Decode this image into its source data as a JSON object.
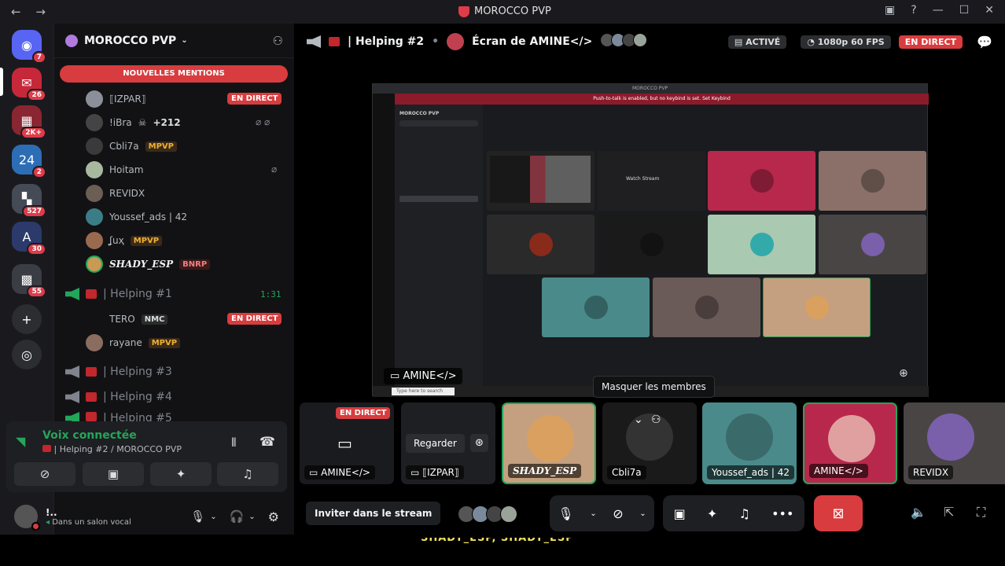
{
  "window": {
    "title": "MOROCCO PVP"
  },
  "colors": {
    "accent_red": "#d83c3e",
    "online_green": "#23a55a",
    "tag_gold": "#f0b132"
  },
  "rail": {
    "servers": [
      {
        "icon": "discord-icon",
        "badge": "7"
      },
      {
        "icon": "server-icon",
        "badge": "26"
      },
      {
        "icon": "server-icon",
        "badge": "2K+"
      },
      {
        "icon": "server-icon",
        "badge": "2"
      },
      {
        "icon": "server-icon",
        "badge": "527"
      },
      {
        "icon": "server-icon",
        "badge": "30"
      },
      {
        "icon": "server-icon",
        "badge": "55"
      }
    ]
  },
  "sidebar": {
    "server_name": "MOROCCO PVP",
    "mentions_banner": "NOUVELLES MENTIONS",
    "members": [
      {
        "name": "⟦IZPAR⟧",
        "live": "EN DIRECT"
      },
      {
        "name": "!iBra",
        "extra": "+212"
      },
      {
        "name": "Cbli7a",
        "tag": "MPVP"
      },
      {
        "name": "Hoitam"
      },
      {
        "name": "REVIDX"
      },
      {
        "name": "Youssef_ads | 42"
      },
      {
        "name": "ʆuҳ",
        "tag": "MPVP"
      },
      {
        "name": "SHADY_ESP",
        "tag": "BNRP"
      }
    ],
    "channels": [
      {
        "name": "| Helping #1",
        "time": "1:31"
      },
      {
        "name": "| Helping #3"
      },
      {
        "name": "| Helping #4"
      },
      {
        "name": "| Helping #5"
      }
    ],
    "channel1_members": [
      {
        "name": "TERO",
        "tag": "NMC",
        "live": "EN DIRECT"
      },
      {
        "name": "rayane",
        "tag": "MPVP"
      }
    ],
    "voice": {
      "title": "Voix connectée",
      "subtitle": "| Helping #2 / MOROCCO PVP"
    },
    "user": {
      "name": "!..",
      "status": "Dans un salon vocal"
    }
  },
  "header": {
    "channel": "| Helping #2",
    "screen_title": "Écran de AMINE</>",
    "active": "ACTIVÉ",
    "quality": "1080p 60 FPS",
    "live": "EN DIRECT"
  },
  "stream": {
    "title_bar": "MOROCCO PVP",
    "notice": "Push-to-talk is enabled, but no keybind is set.   Set Keybind",
    "watch_label": "Watch Stream",
    "owner_label": "AMINE</>",
    "taskbar_search": "Type here to search"
  },
  "tooltip": "Masquer les membres",
  "tiles": [
    {
      "label": "AMINE</>",
      "live": "EN DIRECT"
    },
    {
      "label": "⟦IZPAR⟧",
      "watch": "Regarder"
    },
    {
      "label": "SHADY_ESP"
    },
    {
      "label": "Cbli7a"
    },
    {
      "label": "Youssef_ads | 42"
    },
    {
      "label": "AMINE</>"
    },
    {
      "label": "REVIDX"
    }
  ],
  "controls": {
    "invite": "Inviter dans le stream"
  },
  "caption": "SHADY_ESP, SHADY_ESP"
}
